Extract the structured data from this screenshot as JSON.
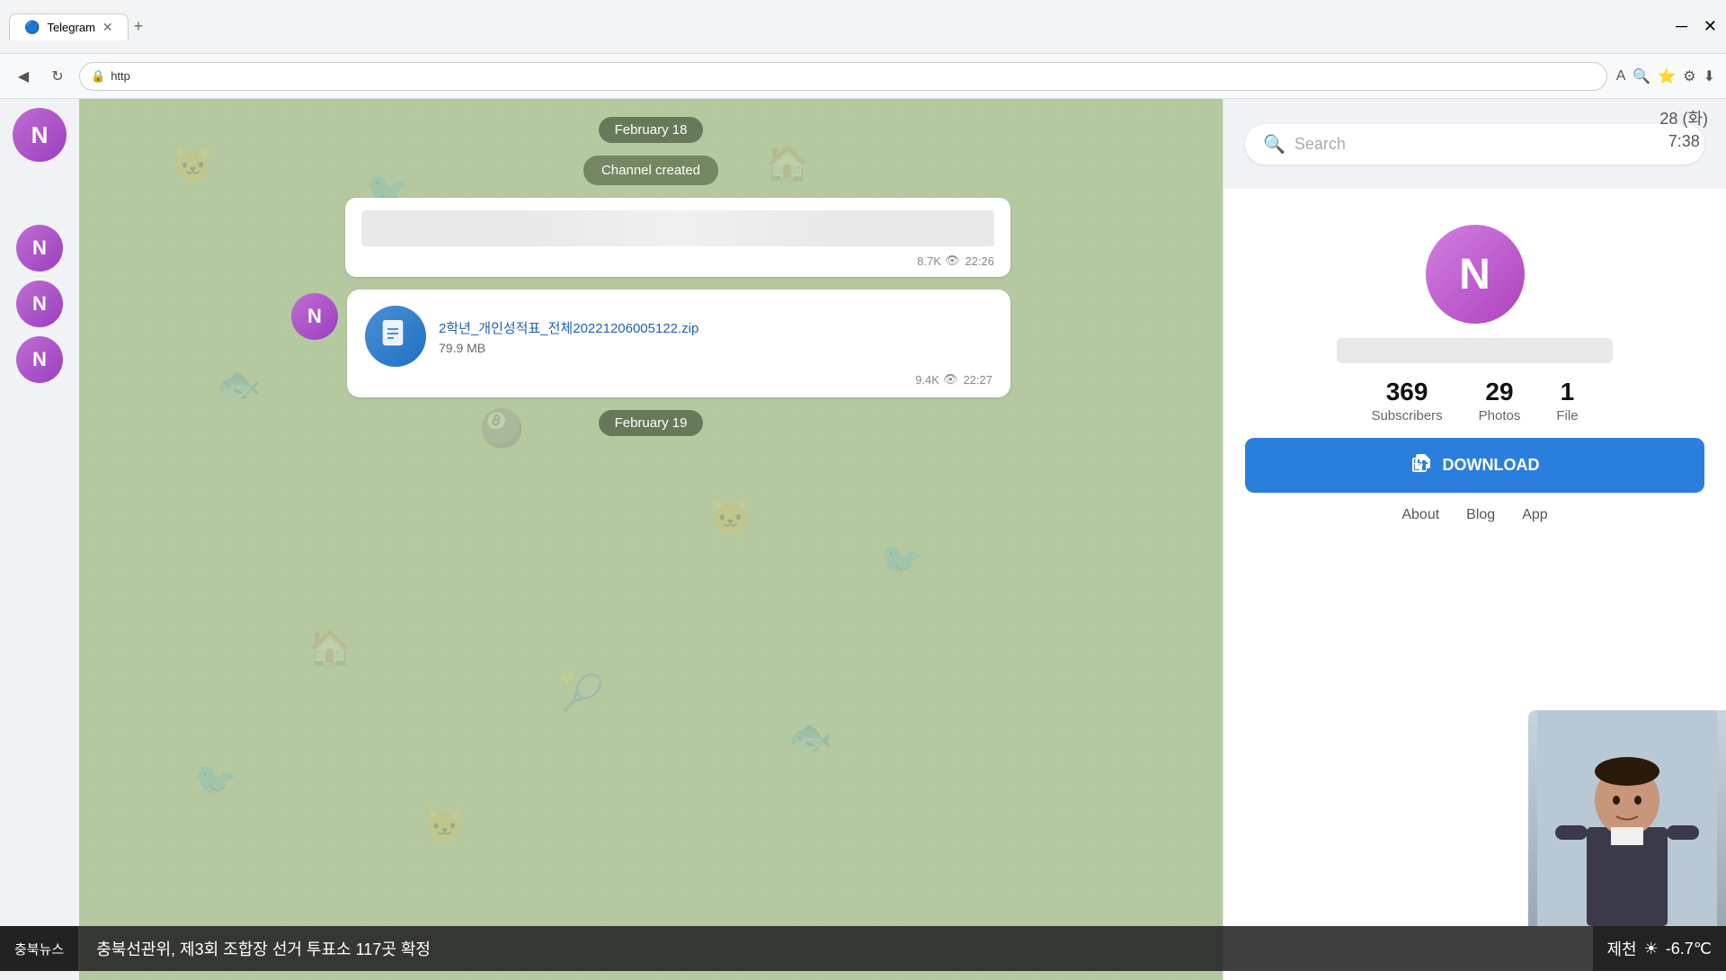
{
  "browser": {
    "tab_label": "Telegram",
    "url": "http",
    "back_icon": "◀",
    "reload_icon": "↻",
    "add_tab_icon": "+",
    "close_tab_icon": "✕"
  },
  "datetime": {
    "date": "28 (화)",
    "time": "7:38"
  },
  "search": {
    "placeholder": "Search"
  },
  "chat": {
    "date1": "February 18",
    "system_msg": "Channel created",
    "msg1": {
      "views": "8.7K",
      "time": "22:26"
    },
    "file_msg": {
      "filename": "2학년_개인성적표_전체20221206005122.zip",
      "filesize": "79.9 MB",
      "views": "9.4K",
      "time": "22:27"
    },
    "date2": "February 19"
  },
  "channel": {
    "avatar_letter": "N",
    "subscribers_count": "369",
    "subscribers_label": "Subscribers",
    "photos_count": "29",
    "photos_label": "Photos",
    "files_count": "1",
    "files_label": "File",
    "download_label": "DOWNLOAD"
  },
  "panel_links": {
    "about": "About",
    "blog": "Blog",
    "apps": "App"
  },
  "news": {
    "source": "충북뉴스",
    "text": "충북선관위, 제3회 조합장 선거 투표소 117곳 확정"
  },
  "weather": {
    "city": "제천",
    "icon": "☀",
    "temp": "-6.7℃"
  },
  "avatar_letter": "N"
}
